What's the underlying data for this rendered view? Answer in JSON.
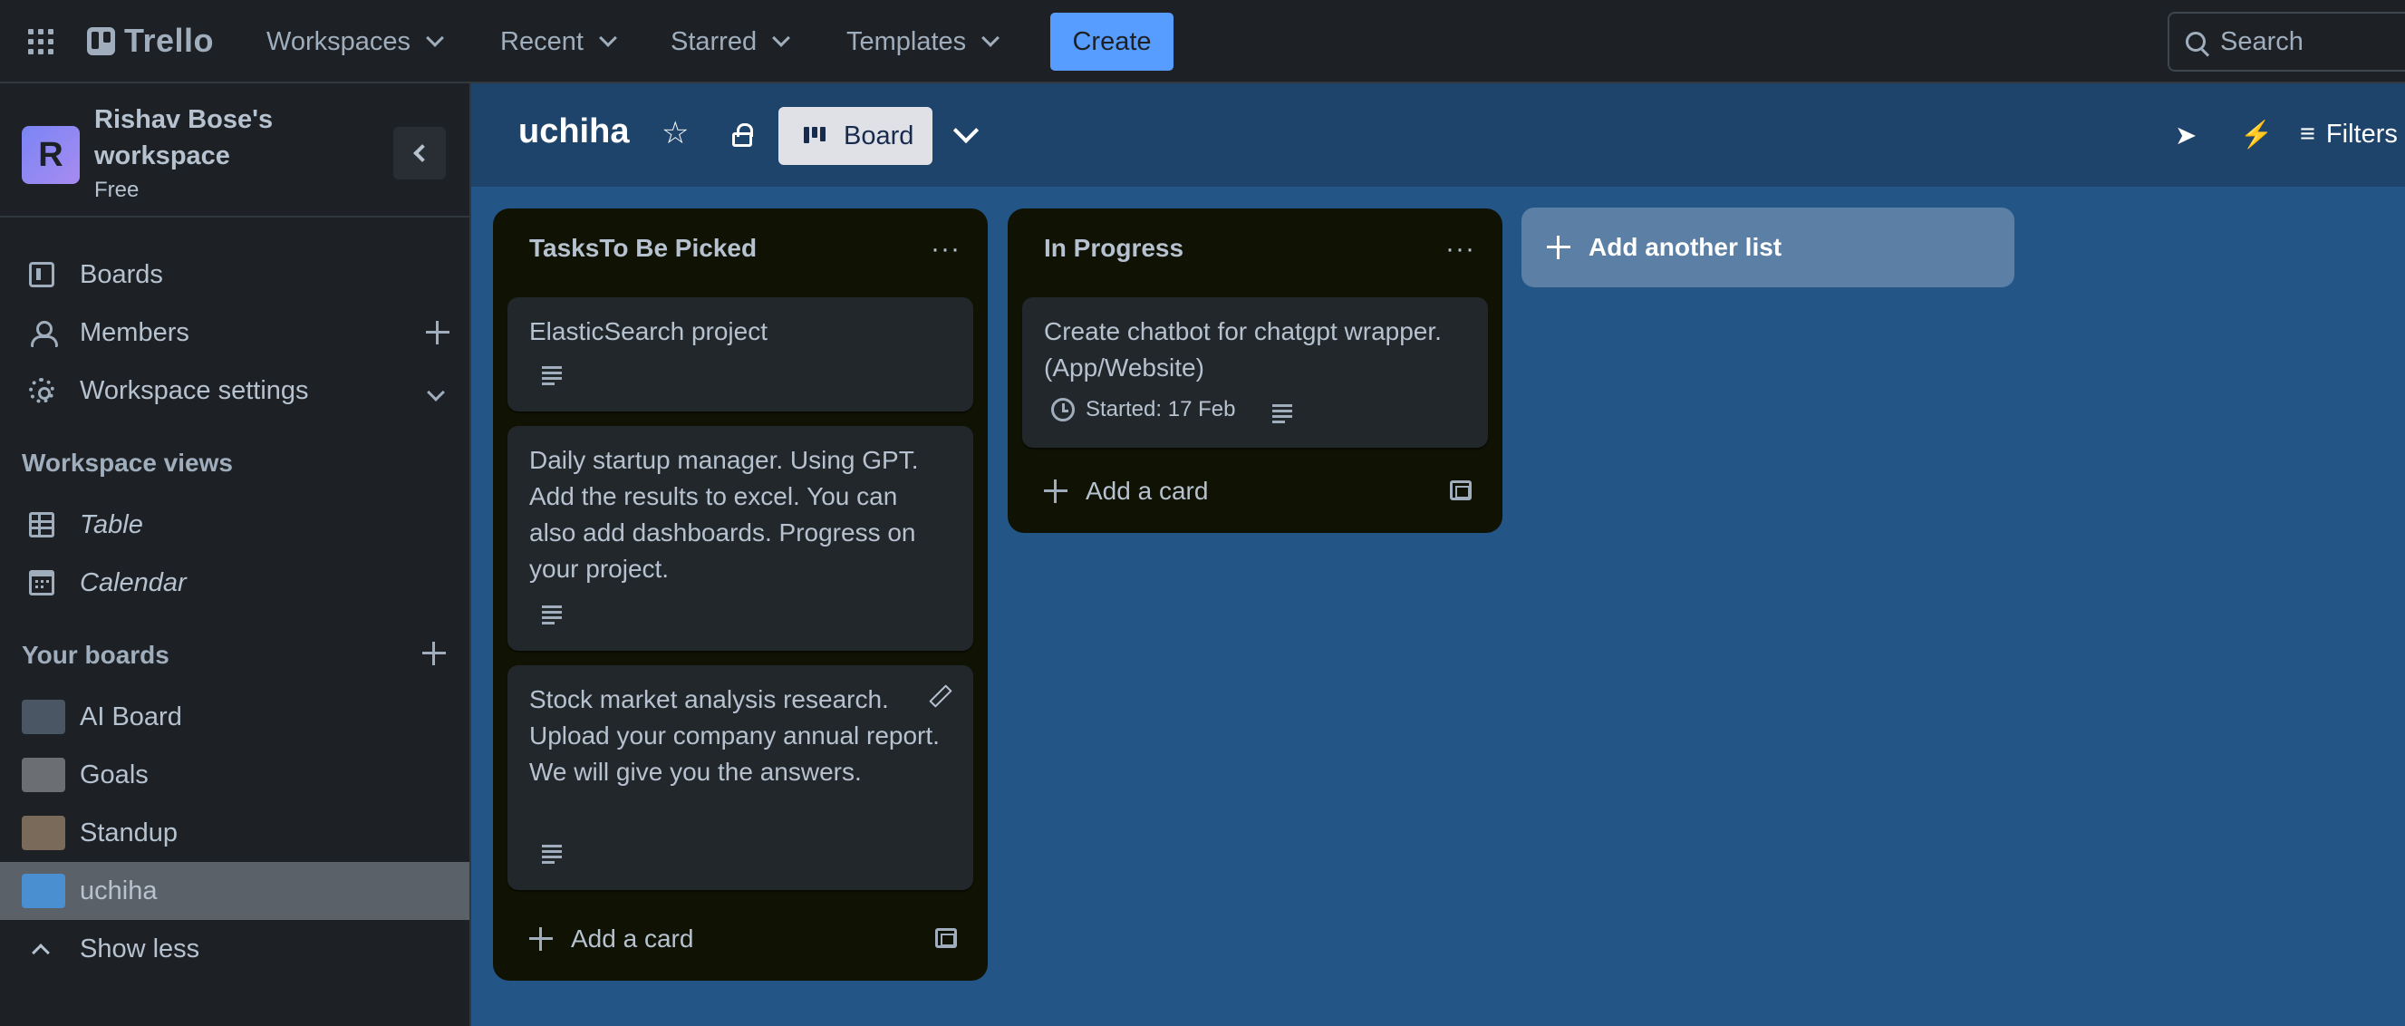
{
  "topbar": {
    "app_name": "Trello",
    "nav": [
      "Workspaces",
      "Recent",
      "Starred",
      "Templates"
    ],
    "create_label": "Create",
    "search_placeholder": "Search"
  },
  "sidebar": {
    "workspace_name": "Rishav Bose's workspace",
    "workspace_initial": "R",
    "workspace_plan": "Free",
    "items": [
      {
        "label": "Boards",
        "icon": "board-icon"
      },
      {
        "label": "Members",
        "icon": "members-icon"
      },
      {
        "label": "Workspace settings",
        "icon": "gear-icon"
      }
    ],
    "views_title": "Workspace views",
    "views": [
      {
        "label": "Table",
        "icon": "table-icon"
      },
      {
        "label": "Calendar",
        "icon": "calendar-icon"
      }
    ],
    "boards_title": "Your boards",
    "boards": [
      {
        "label": "AI Board",
        "color": "#4a5663"
      },
      {
        "label": "Goals",
        "color": "#6b6f73"
      },
      {
        "label": "Standup",
        "color": "#7a6a5a"
      },
      {
        "label": "uchiha",
        "color": "#4a8fcf"
      }
    ],
    "show_less": "Show less"
  },
  "board": {
    "title": "uchiha",
    "view_label": "Board",
    "filters_label": "Filters",
    "background_color": "#245587",
    "lists": [
      {
        "title": "TasksTo Be Picked",
        "cards": [
          {
            "text": "ElasticSearch project"
          },
          {
            "text": "Daily startup manager. Using GPT. Add the results to excel. You can also add dashboards. Progress on your project."
          },
          {
            "text": "Stock market analysis research. Upload your company annual report. We will give you the answers."
          }
        ],
        "add_card": "Add a card"
      },
      {
        "title": "In Progress",
        "cards": [
          {
            "text": "Create chatbot for chatgpt wrapper. (App/Website)",
            "date_badge": "Started: 17 Feb"
          }
        ],
        "add_card": "Add a card"
      }
    ],
    "add_list": "Add another list"
  }
}
